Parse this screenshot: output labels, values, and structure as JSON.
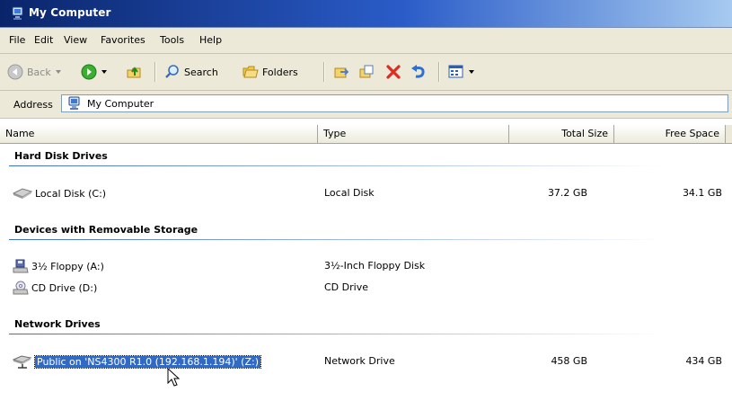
{
  "window": {
    "title": "My Computer"
  },
  "menu": [
    "File",
    "Edit",
    "View",
    "Favorites",
    "Tools",
    "Help"
  ],
  "toolbar": {
    "back": "Back",
    "search": "Search",
    "folders": "Folders"
  },
  "address": {
    "label": "Address",
    "value": "My Computer"
  },
  "columns": {
    "name": "Name",
    "type": "Type",
    "total": "Total Size",
    "free": "Free Space"
  },
  "groups": [
    {
      "title": "Hard Disk Drives",
      "items": [
        {
          "name": "Local Disk (C:)",
          "type": "Local Disk",
          "total": "37.2 GB",
          "free": "34.1 GB",
          "icon": "hard-disk-icon"
        }
      ]
    },
    {
      "title": "Devices with Removable Storage",
      "items": [
        {
          "name": "3½ Floppy (A:)",
          "type": "3½-Inch Floppy Disk",
          "total": "",
          "free": "",
          "icon": "floppy-drive-icon"
        },
        {
          "name": "CD Drive (D:)",
          "type": "CD Drive",
          "total": "",
          "free": "",
          "icon": "cd-drive-icon"
        }
      ]
    },
    {
      "title": "Network Drives",
      "items": [
        {
          "name": "Public on 'NS4300 R1.0 (192.168.1.194)' (Z:)",
          "type": "Network Drive",
          "total": "458 GB",
          "free": "434 GB",
          "icon": "network-drive-icon",
          "selected": true
        }
      ]
    }
  ],
  "colors": {
    "title_bar": "#0a246a",
    "selection": "#316ac5",
    "group_line": "#3f6ec8"
  }
}
